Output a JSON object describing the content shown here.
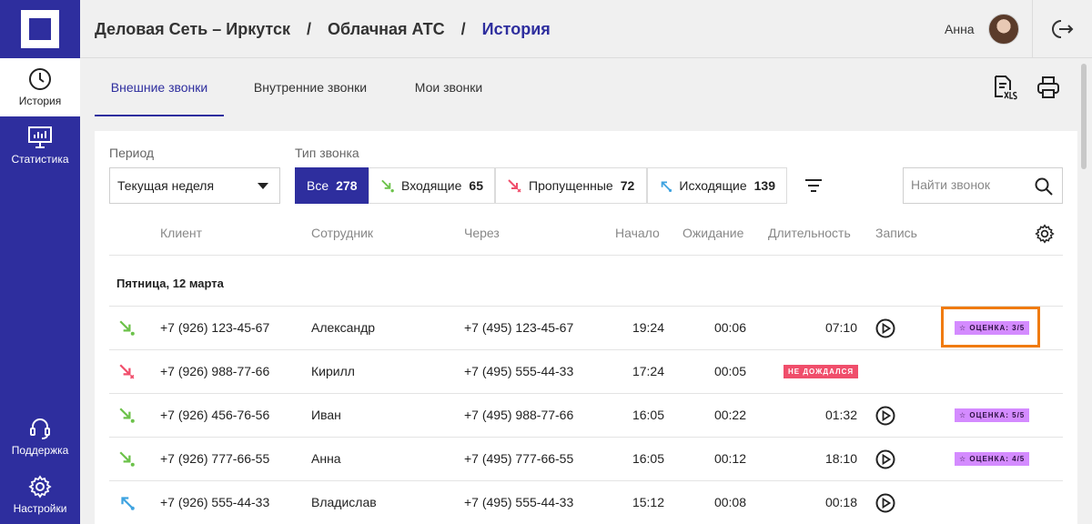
{
  "sidebar": {
    "items": [
      {
        "label": "История",
        "icon": "clock-icon"
      },
      {
        "label": "Статистика",
        "icon": "chart-monitor-icon"
      },
      {
        "label": "Поддержка",
        "icon": "headset-icon"
      },
      {
        "label": "Настройки",
        "icon": "gear-icon"
      }
    ]
  },
  "header": {
    "breadcrumb": [
      "Деловая Сеть – Иркутск",
      "Облачная АТС",
      "История"
    ],
    "separator": "/",
    "user_name": "Анна"
  },
  "tabs": [
    "Внешние звонки",
    "Внутренние звонки",
    "Мои звонки"
  ],
  "filters": {
    "period_label": "Период",
    "period_value": "Текущая неделя",
    "type_label": "Тип звонка",
    "types": [
      {
        "label": "Все",
        "count": "278"
      },
      {
        "label": "Входящие",
        "count": "65"
      },
      {
        "label": "Пропущенные",
        "count": "72"
      },
      {
        "label": "Исходящие",
        "count": "139"
      }
    ],
    "search_placeholder": "Найти звонок"
  },
  "table": {
    "columns": [
      "Клиент",
      "Сотрудник",
      "Через",
      "Начало",
      "Ожидание",
      "Длительность",
      "Запись"
    ],
    "group": "Пятница, 12 марта",
    "rows": [
      {
        "type": "incoming",
        "client": "+7 (926) 123-45-67",
        "employee": "Александр",
        "via": "+7 (495) 123-45-67",
        "start": "19:24",
        "wait": "00:06",
        "duration": "07:10",
        "record": true,
        "badge": "ОЦЕНКА: 3/5"
      },
      {
        "type": "missed",
        "client": "+7 (926) 988-77-66",
        "employee": "Кирилл",
        "via": "+7 (495) 555-44-33",
        "start": "17:24",
        "wait": "00:05",
        "duration": "НЕ ДОЖДАЛСЯ",
        "record": false,
        "badge": ""
      },
      {
        "type": "incoming",
        "client": "+7 (926) 456-76-56",
        "employee": "Иван",
        "via": "+7 (495) 988-77-66",
        "start": "16:05",
        "wait": "00:22",
        "duration": "01:32",
        "record": true,
        "badge": "ОЦЕНКА: 5/5"
      },
      {
        "type": "incoming",
        "client": "+7 (926) 777-66-55",
        "employee": "Анна",
        "via": "+7 (495) 777-66-55",
        "start": "16:05",
        "wait": "00:12",
        "duration": "18:10",
        "record": true,
        "badge": "ОЦЕНКА: 4/5"
      },
      {
        "type": "outgoing",
        "client": "+7 (926) 555-44-33",
        "employee": "Владислав",
        "via": "+7 (495) 555-44-33",
        "start": "15:12",
        "wait": "00:08",
        "duration": "00:18",
        "record": true,
        "badge": ""
      }
    ]
  },
  "colors": {
    "brand": "#2e2e9e",
    "incoming": "#6cc24a",
    "missed": "#f04e6b",
    "outgoing": "#3fa3e0",
    "rating": "#d48bff",
    "highlight": "#f07b10"
  }
}
